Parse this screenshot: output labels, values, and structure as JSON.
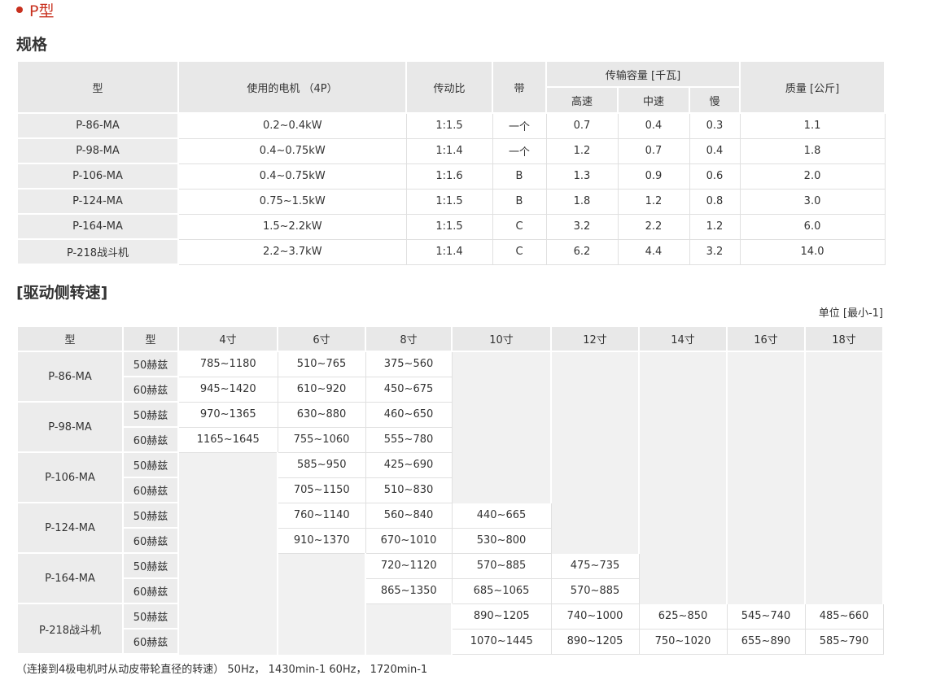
{
  "section": {
    "title": "P型"
  },
  "spec": {
    "heading": "规格",
    "headers": {
      "model": "型",
      "motor": "使用的电机 （4P）",
      "ratio": "传动比",
      "belt": "带",
      "capacity": "传输容量 [千瓦]",
      "high": "高速",
      "mid": "中速",
      "low": "慢",
      "mass": "质量 [公斤]"
    },
    "rows": [
      {
        "model": "P-86-MA",
        "motor": "0.2~0.4kW",
        "ratio": "1:1.5",
        "belt": "一个",
        "high": "0.7",
        "mid": "0.4",
        "low": "0.3",
        "mass": "1.1"
      },
      {
        "model": "P-98-MA",
        "motor": "0.4~0.75kW",
        "ratio": "1:1.4",
        "belt": "一个",
        "high": "1.2",
        "mid": "0.7",
        "low": "0.4",
        "mass": "1.8"
      },
      {
        "model": "P-106-MA",
        "motor": "0.4~0.75kW",
        "ratio": "1:1.6",
        "belt": "B",
        "high": "1.3",
        "mid": "0.9",
        "low": "0.6",
        "mass": "2.0"
      },
      {
        "model": "P-124-MA",
        "motor": "0.75~1.5kW",
        "ratio": "1:1.5",
        "belt": "B",
        "high": "1.8",
        "mid": "1.2",
        "low": "0.8",
        "mass": "3.0"
      },
      {
        "model": "P-164-MA",
        "motor": "1.5~2.2kW",
        "ratio": "1:1.5",
        "belt": "C",
        "high": "3.2",
        "mid": "2.2",
        "low": "1.2",
        "mass": "6.0"
      },
      {
        "model": "P-218战斗机",
        "motor": "2.2~3.7kW",
        "ratio": "1:1.4",
        "belt": "C",
        "high": "6.2",
        "mid": "4.4",
        "low": "3.2",
        "mass": "14.0"
      }
    ]
  },
  "speed": {
    "heading": "[驱动侧转速]",
    "unit": "单位 [最小-1]",
    "headers": [
      "型",
      "型",
      "4寸",
      "6寸",
      "8寸",
      "10寸",
      "12寸",
      "14寸",
      "16寸",
      "18寸"
    ],
    "hz50": "50赫兹",
    "hz60": "60赫兹",
    "models": [
      {
        "model": "P-86-MA",
        "r50": [
          "785~1180",
          "510~765",
          "375~560",
          "",
          "",
          "",
          "",
          ""
        ],
        "r60": [
          "945~1420",
          "610~920",
          "450~675",
          "",
          "",
          "",
          "",
          ""
        ]
      },
      {
        "model": "P-98-MA",
        "r50": [
          "970~1365",
          "630~880",
          "460~650",
          "",
          "",
          "",
          "",
          ""
        ],
        "r60": [
          "1165~1645",
          "755~1060",
          "555~780",
          "",
          "",
          "",
          "",
          ""
        ]
      },
      {
        "model": "P-106-MA",
        "r50": [
          "",
          "585~950",
          "425~690",
          "",
          "",
          "",
          "",
          ""
        ],
        "r60": [
          "",
          "705~1150",
          "510~830",
          "",
          "",
          "",
          "",
          ""
        ]
      },
      {
        "model": "P-124-MA",
        "r50": [
          "",
          "760~1140",
          "560~840",
          "440~665",
          "",
          "",
          "",
          ""
        ],
        "r60": [
          "",
          "910~1370",
          "670~1010",
          "530~800",
          "",
          "",
          "",
          ""
        ]
      },
      {
        "model": "P-164-MA",
        "r50": [
          "",
          "",
          "720~1120",
          "570~885",
          "475~735",
          "",
          "",
          ""
        ],
        "r60": [
          "",
          "",
          "865~1350",
          "685~1065",
          "570~885",
          "",
          "",
          ""
        ]
      },
      {
        "model": "P-218战斗机",
        "r50": [
          "",
          "",
          "",
          "890~1205",
          "740~1000",
          "625~850",
          "545~740",
          "485~660"
        ],
        "r60": [
          "",
          "",
          "",
          "1070~1445",
          "890~1205",
          "750~1020",
          "655~890",
          "585~790"
        ]
      }
    ],
    "note": "（连接到4极电机时从动皮带轮直径的转速） 50Hz， 1430min-1 60Hz， 1720min-1"
  }
}
